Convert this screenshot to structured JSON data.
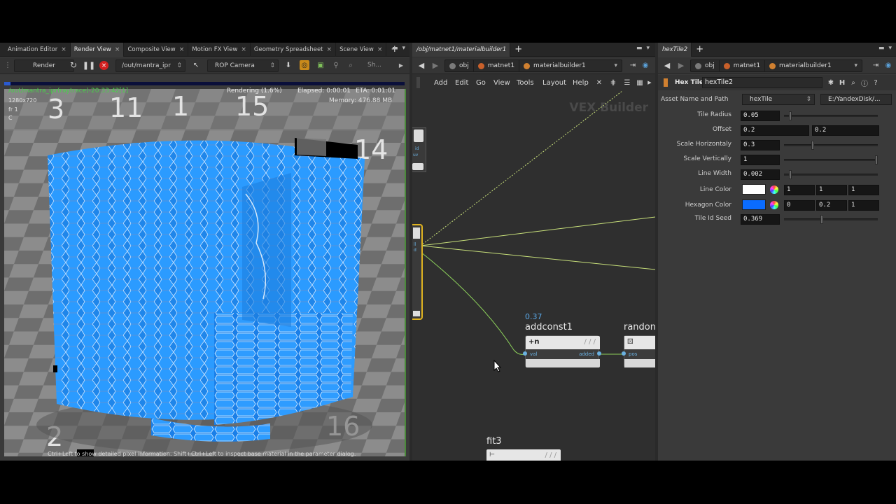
{
  "left_panel": {
    "tabs": [
      {
        "label": "Animation Editor"
      },
      {
        "label": "Render View"
      },
      {
        "label": "Composite View"
      },
      {
        "label": "Motion FX View"
      },
      {
        "label": "Geometry Spreadsheet"
      },
      {
        "label": "Scene View"
      }
    ],
    "toolbar": {
      "render_label": "Render",
      "output_path": "/out/mantra_ipr",
      "camera": "ROP Camera",
      "sh_label": "Sh..."
    },
    "overlay": {
      "title": "/out/mantra_ipr(raytrace)-20:33:42[1]",
      "status": "Rendering (1.6%)",
      "elapsed": "Elapsed: 0:00:01",
      "eta": "ETA: 0:01:01",
      "resolution": "1280x720",
      "frame": "fr 1",
      "channel": "C",
      "memory": "Memory:  476.88 MB"
    },
    "hint": "Ctrl+Left to show detailed pixel information. Shift+Ctrl+Left to inspect base material in the parameter dialog.",
    "floor_numbers": [
      "3",
      "11",
      "1",
      "15",
      "14",
      "2",
      "16"
    ]
  },
  "middle_panel": {
    "tab": "/obj/matnet1/materialbuilder1",
    "path": [
      {
        "label": "obj"
      },
      {
        "label": "matnet1"
      },
      {
        "label": "materialbuilder1"
      }
    ],
    "menu": [
      "Add",
      "Edit",
      "Go",
      "View",
      "Tools",
      "Layout",
      "Help"
    ],
    "watermark": "VEX Builder",
    "nodes": {
      "addconst": {
        "value": "0.37",
        "name": "addconst1",
        "icon": "+n",
        "in": "val",
        "out": "added"
      },
      "random": {
        "name": "randon",
        "in": "pos"
      },
      "fit": {
        "name": "fit3"
      },
      "global_ports": [
        "id",
        "uv"
      ],
      "param_ports": [
        "ll",
        "d"
      ]
    }
  },
  "right_panel": {
    "tab": "hexTile2",
    "path": [
      {
        "label": "obj"
      },
      {
        "label": "matnet1"
      },
      {
        "label": "materialbuilder1"
      }
    ],
    "node_type": "Hex Tile",
    "node_name": "hexTile2",
    "asset_label": "Asset Name and Path",
    "asset_name": "hexTile",
    "asset_path": "E:/YandexDisk/...",
    "params": {
      "tile_radius": {
        "label": "Tile Radius",
        "value": "0.05",
        "slider": 0.05
      },
      "offset": {
        "label": "Offset",
        "x": "0.2",
        "y": "0.2"
      },
      "scale_h": {
        "label": "Scale Horizontaly",
        "value": "0.3",
        "slider": 0.3
      },
      "scale_v": {
        "label": "Scale Vertically",
        "value": "1",
        "slider": 1.0
      },
      "line_width": {
        "label": "Line Width",
        "value": "0.002",
        "slider": 0.05
      },
      "line_color": {
        "label": "Line Color",
        "r": "1",
        "g": "1",
        "b": "1",
        "swatch": "#ffffff"
      },
      "hex_color": {
        "label": "Hexagon Color",
        "r": "0",
        "g": "0.2",
        "b": "1",
        "swatch": "#0a6cff"
      },
      "tile_seed": {
        "label": "Tile Id Seed",
        "value": "0.369",
        "slider": 0.4
      }
    }
  },
  "colors": {
    "accent_green": "#9ccc50",
    "hex_blue": "#1a8cff",
    "wire": "#c8e07a"
  }
}
